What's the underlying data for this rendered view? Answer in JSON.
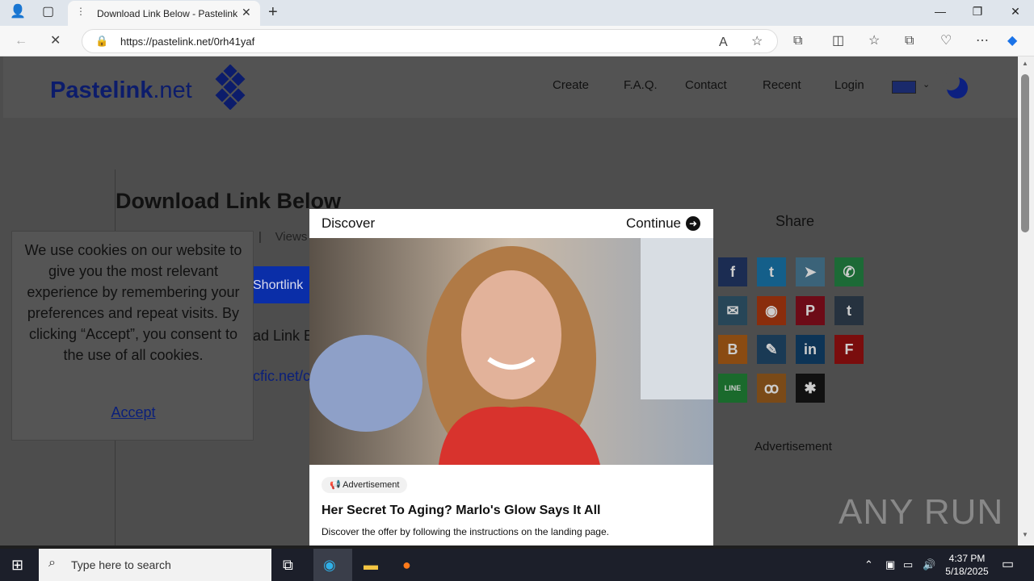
{
  "browser": {
    "tab_title": "Download Link Below - Pastelink",
    "url": "https://pastelink.net/0rh41yaf"
  },
  "site": {
    "logo_bold": "Pastelink",
    "logo_suffix": ".net",
    "nav": [
      "Create",
      "F.A.Q.",
      "Contact",
      "Recent",
      "Login"
    ],
    "heading": "Download Link Below",
    "views_label": "Views",
    "shortlink_button": "Shortlink",
    "download_text": "ad Link B",
    "link_text": "cfic.net/c",
    "share_title": "Share",
    "advertisement_label": "Advertisement"
  },
  "share_icons": [
    {
      "name": "facebook-icon",
      "glyph": "f",
      "color": "#1b2c52"
    },
    {
      "name": "twitter-icon",
      "glyph": "t",
      "color": "#145f8a"
    },
    {
      "name": "telegram-icon",
      "glyph": "➤",
      "color": "#3b6379"
    },
    {
      "name": "whatsapp-icon",
      "glyph": "✆",
      "color": "#1c6a36"
    },
    {
      "name": "email-icon",
      "glyph": "✉",
      "color": "#274658"
    },
    {
      "name": "reddit-icon",
      "glyph": "◉",
      "color": "#8a2d0c"
    },
    {
      "name": "pinterest-icon",
      "glyph": "P",
      "color": "#6d0b17"
    },
    {
      "name": "tumblr-icon",
      "glyph": "t",
      "color": "#26323f"
    },
    {
      "name": "blogger-icon",
      "glyph": "B",
      "color": "#8a4b12"
    },
    {
      "name": "livejournal-icon",
      "glyph": "✎",
      "color": "#1a3a55"
    },
    {
      "name": "linkedin-icon",
      "glyph": "in",
      "color": "#0d3456"
    },
    {
      "name": "flipboard-icon",
      "glyph": "F",
      "color": "#7a0d0d"
    },
    {
      "name": "line-icon",
      "glyph": "LINE",
      "color": "#1a6a2c"
    },
    {
      "name": "mix-icon",
      "glyph": "ꝏ",
      "color": "#7a4a18"
    },
    {
      "name": "delicious-icon",
      "glyph": "✱",
      "color": "#111111"
    }
  ],
  "cookie": {
    "message": "We use cookies on our website to give you the most relevant experience by remembering your preferences and repeat visits. By clicking “Accept”, you consent to the use of all cookies.",
    "accept": "Accept"
  },
  "modal": {
    "header_left": "Discover",
    "header_right": "Continue",
    "badge": "Advertisement",
    "headline": "Her Secret To Aging? Marlo's Glow Says It All",
    "description": "Discover the offer by following the instructions on the landing page."
  },
  "watermark": "ANY RUN",
  "taskbar": {
    "search_placeholder": "Type here to search",
    "time": "4:37 PM",
    "date": "5/18/2025"
  }
}
